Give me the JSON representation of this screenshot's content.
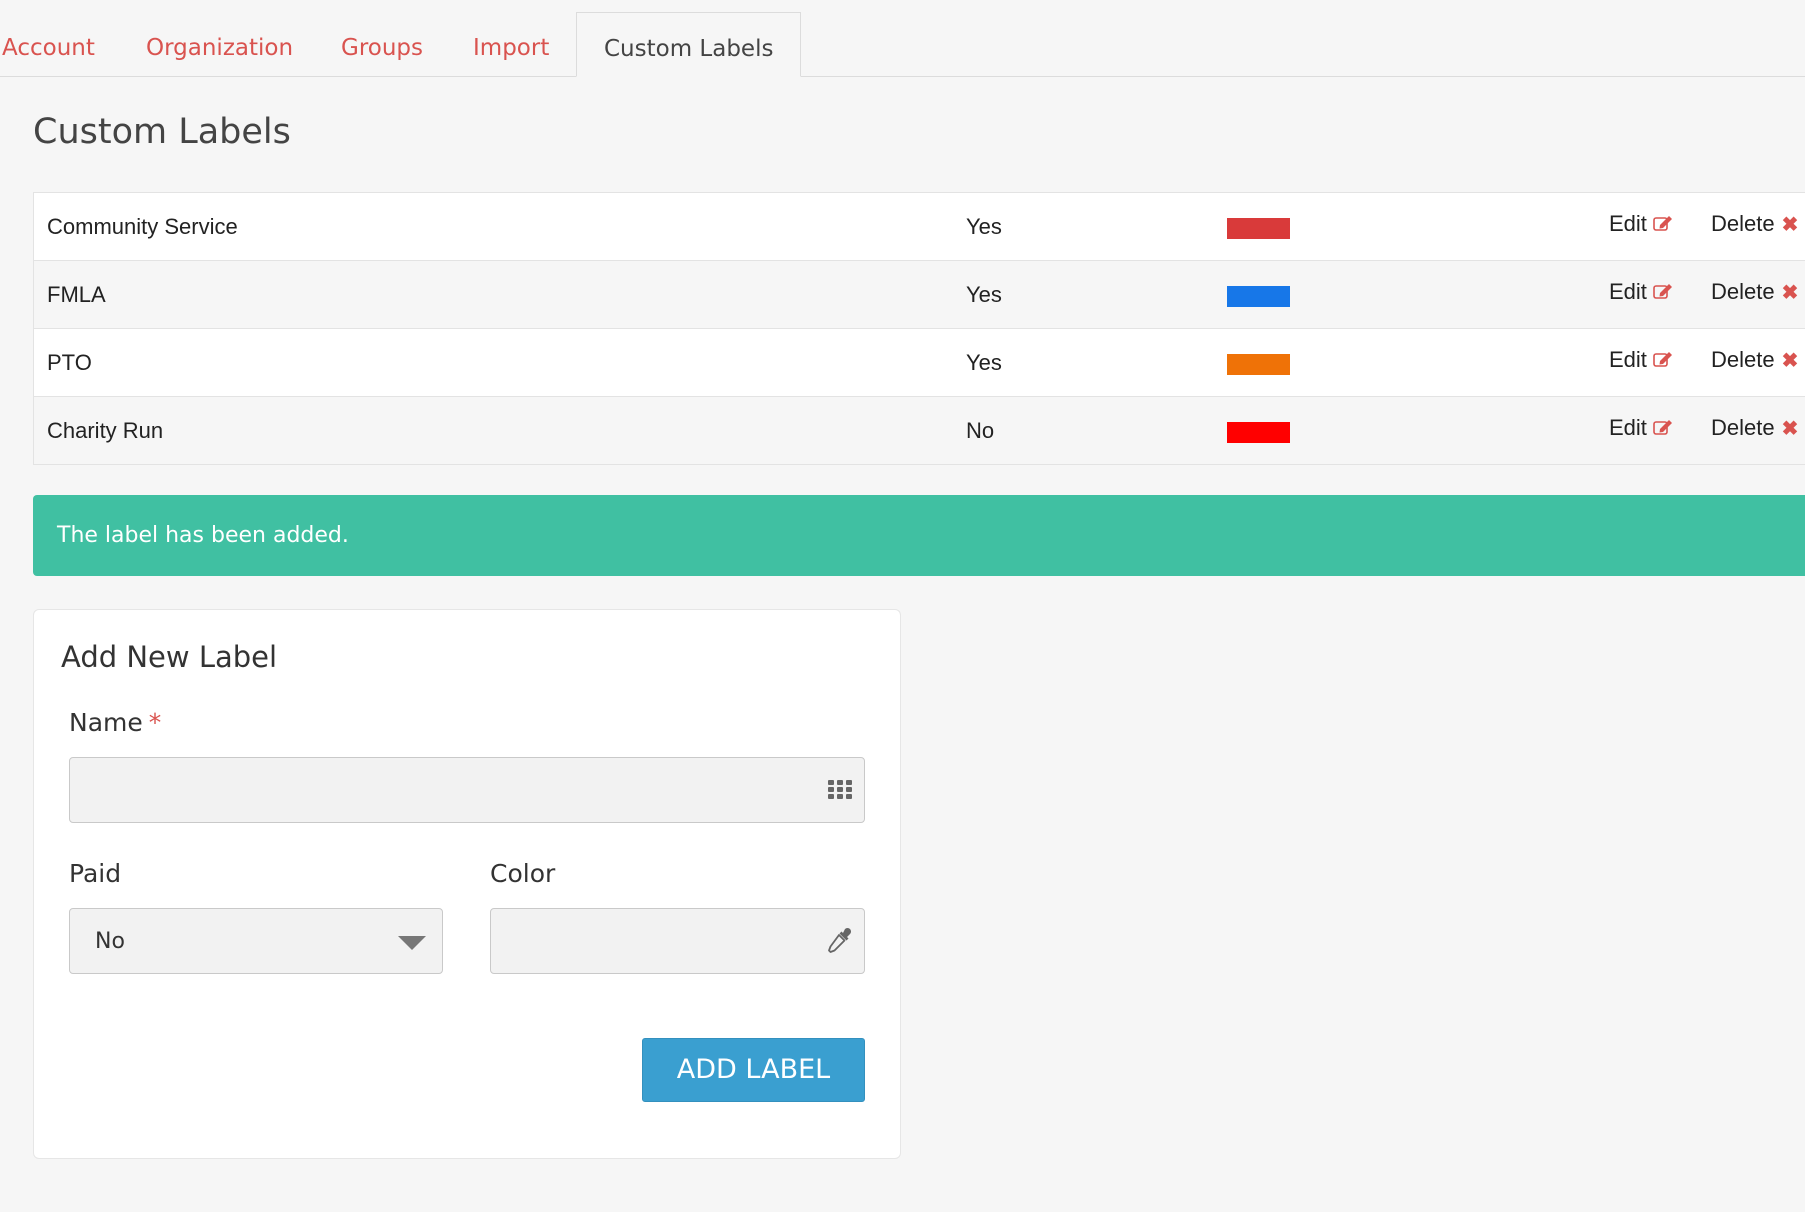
{
  "tabs": [
    {
      "label": "Account"
    },
    {
      "label": "Organization"
    },
    {
      "label": "Groups"
    },
    {
      "label": "Import"
    },
    {
      "label": "Custom Labels",
      "active": true
    }
  ],
  "page_title": "Custom Labels",
  "labels": [
    {
      "name": "Community Service",
      "paid": "Yes",
      "color": "#d93a3a",
      "edit": "Edit",
      "delete": "Delete"
    },
    {
      "name": "FMLA",
      "paid": "Yes",
      "color": "#1777e8",
      "edit": "Edit",
      "delete": "Delete"
    },
    {
      "name": "PTO",
      "paid": "Yes",
      "color": "#ef7207",
      "edit": "Edit",
      "delete": "Delete"
    },
    {
      "name": "Charity Run",
      "paid": "No",
      "color": "#ff0000",
      "edit": "Edit",
      "delete": "Delete"
    }
  ],
  "alert": {
    "message": "The label has been added.",
    "color": "#40c0a2"
  },
  "form": {
    "title": "Add New Label",
    "name_label": "Name",
    "required_mark": "*",
    "name_value": "",
    "paid_label": "Paid",
    "paid_value": "No",
    "color_label": "Color",
    "color_value": "",
    "submit_label": "ADD LABEL"
  },
  "icons": {
    "edit": "edit-icon",
    "delete": "close-icon",
    "keypad": "keypad-icon",
    "eyedropper": "eyedropper-icon",
    "caret": "caret-down-icon"
  },
  "colors": {
    "accent": "#d9534f",
    "button": "#3a9fd0"
  }
}
